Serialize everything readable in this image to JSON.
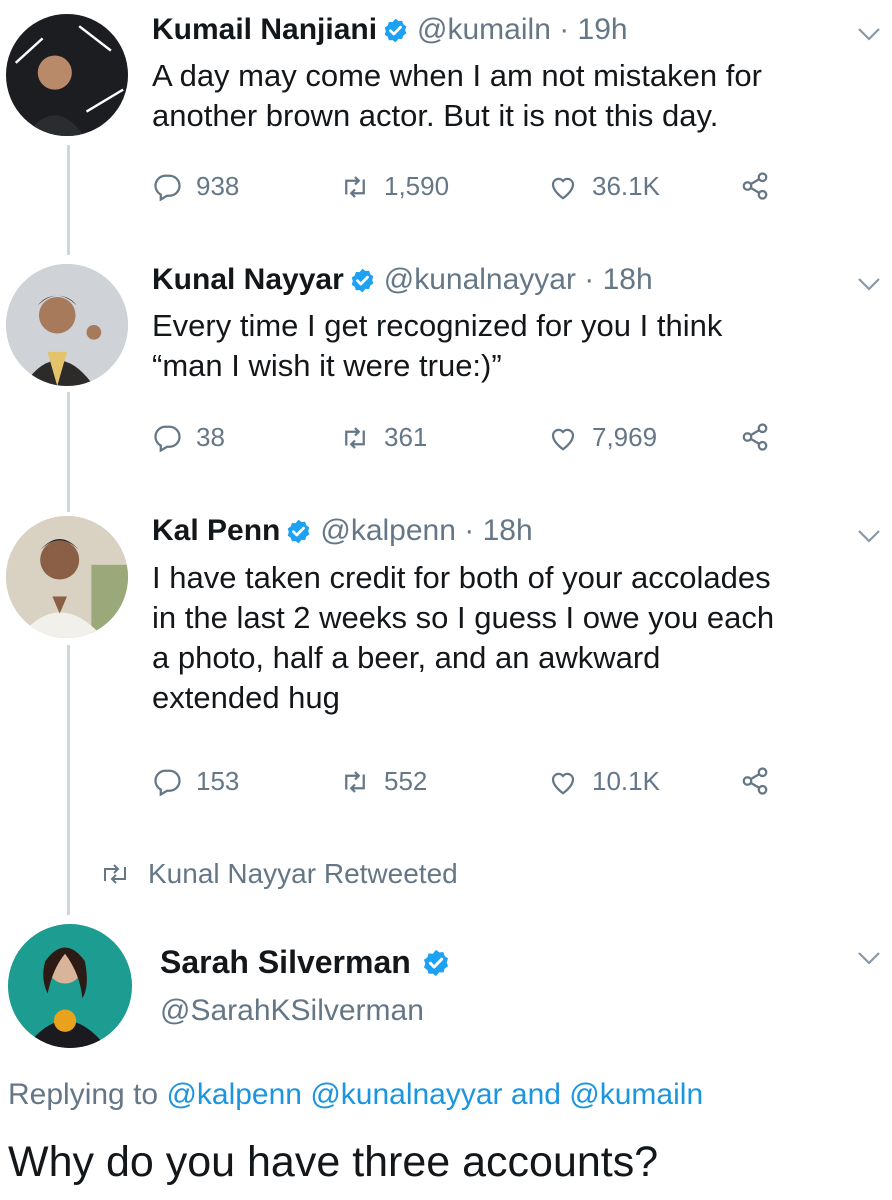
{
  "tweets": [
    {
      "name": "Kumail Nanjiani",
      "handle": "@kumailn · 19h",
      "text": [
        "A day may come when I am not mistaken for",
        "another brown actor. But it is not this day."
      ],
      "replies": "938",
      "retweets": "1,590",
      "likes": "36.1K"
    },
    {
      "name": "Kunal Nayyar",
      "handle": "@kunalnayyar · 18h",
      "text": [
        "Every time I get recognized for you I think",
        "“man I wish it were true:)”"
      ],
      "replies": "38",
      "retweets": "361",
      "likes": "7,969"
    },
    {
      "name": "Kal Penn",
      "handle": "@kalpenn · 18h",
      "text": [
        "I have taken credit for both of your accolades",
        "in the last 2 weeks so I guess I owe you each",
        "a photo, half a beer, and an awkward",
        "extended hug"
      ],
      "replies": "153",
      "retweets": "552",
      "likes": "10.1K"
    }
  ],
  "retweet_note": "Kunal Nayyar Retweeted",
  "reply_tweet": {
    "name": "Sarah Silverman",
    "handle": "@SarahKSilverman",
    "replying_prefix": "Replying to",
    "mentions": [
      "@kalpenn",
      "@kunalnayyar",
      "and",
      "@kumailn"
    ],
    "text": "Why do you have three accounts?"
  },
  "colors": {
    "verified": "#1da1f2",
    "link": "#1b95e0",
    "muted": "#657786"
  },
  "icons": [
    "reply-icon",
    "retweet-icon",
    "like-icon",
    "share-icon",
    "verified-badge-icon",
    "chevron-down-icon"
  ]
}
